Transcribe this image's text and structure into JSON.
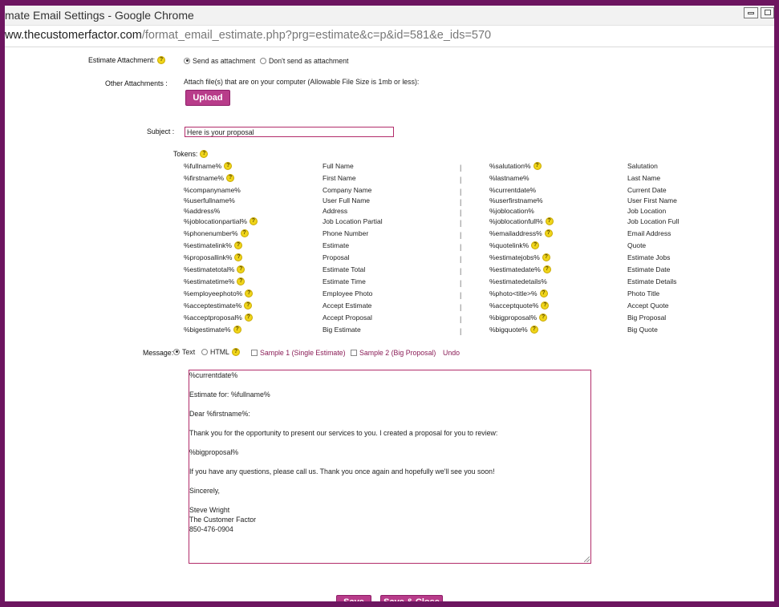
{
  "window": {
    "title": "mate Email Settings - Google Chrome",
    "url_host": "ww.thecustomerfactor.com",
    "url_path": "/format_email_estimate.php?prg=estimate&c=p&id=581&e_ids=570"
  },
  "attachment": {
    "label": "Estimate Attachment:",
    "option_send": "Send as attachment",
    "option_dont": "Don't send as attachment"
  },
  "other_attachments": {
    "label": "Other Attachments :",
    "note": "Attach file(s) that are on your computer (Allowable File Size is 1mb or less):",
    "upload_label": "Upload"
  },
  "subject": {
    "label": "Subject :",
    "value": "Here is your proposal"
  },
  "tokens": {
    "label": "Tokens:",
    "rows": [
      {
        "t1": "%fullname%",
        "h1": true,
        "d1": "Full Name",
        "t2": "%salutation%",
        "h2": true,
        "d2": "Salutation"
      },
      {
        "t1": "%firstname%",
        "h1": true,
        "d1": "First Name",
        "t2": "%lastname%",
        "h2": false,
        "d2": "Last Name"
      },
      {
        "t1": "%companyname%",
        "h1": false,
        "d1": "Company Name",
        "t2": "%currentdate%",
        "h2": false,
        "d2": "Current Date"
      },
      {
        "t1": "%userfullname%",
        "h1": false,
        "d1": "User Full Name",
        "t2": "%userfirstname%",
        "h2": false,
        "d2": "User First Name"
      },
      {
        "t1": "%address%",
        "h1": false,
        "d1": "Address",
        "t2": "%joblocation%",
        "h2": false,
        "d2": "Job Location"
      },
      {
        "t1": "%joblocationpartial%",
        "h1": true,
        "d1": "Job Location Partial",
        "t2": "%joblocationfull%",
        "h2": true,
        "d2": "Job Location Full"
      },
      {
        "t1": "%phonenumber%",
        "h1": true,
        "d1": "Phone Number",
        "t2": "%emailaddress%",
        "h2": true,
        "d2": "Email Address"
      },
      {
        "t1": "%estimatelink%",
        "h1": true,
        "d1": "Estimate",
        "t2": "%quotelink%",
        "h2": true,
        "d2": "Quote"
      },
      {
        "t1": "%proposallink%",
        "h1": true,
        "d1": "Proposal",
        "t2": "%estimatejobs%",
        "h2": true,
        "d2": "Estimate Jobs"
      },
      {
        "t1": "%estimatetotal%",
        "h1": true,
        "d1": "Estimate Total",
        "t2": "%estimatedate%",
        "h2": true,
        "d2": "Estimate Date"
      },
      {
        "t1": "%estimatetime%",
        "h1": true,
        "d1": "Estimate Time",
        "t2": "%estimatedetails%",
        "h2": false,
        "d2": "Estimate Details"
      },
      {
        "t1": "%employeephoto%",
        "h1": true,
        "d1": "Employee Photo",
        "t2": "%photo<title>%",
        "h2": true,
        "d2": "Photo Title"
      },
      {
        "t1": "%acceptestimate%",
        "h1": true,
        "d1": "Accept Estimate",
        "t2": "%acceptquote%",
        "h2": true,
        "d2": "Accept Quote"
      },
      {
        "t1": "%acceptproposal%",
        "h1": true,
        "d1": "Accept Proposal",
        "t2": "%bigproposal%",
        "h2": true,
        "d2": "Big Proposal"
      },
      {
        "t1": "%bigestimate%",
        "h1": true,
        "d1": "Big Estimate",
        "t2": "%bigquote%",
        "h2": true,
        "d2": "Big Quote"
      }
    ],
    "separator": "|",
    "help_glyph": "?"
  },
  "message": {
    "label": "Message:",
    "format_text": "Text",
    "format_html": "HTML",
    "sample1": "Sample 1 (Single Estimate)",
    "sample2": "Sample 2 (Big Proposal)",
    "undo": "Undo",
    "lines": [
      "%currentdate%",
      "",
      "Estimate for: %fullname%",
      "",
      "Dear %firstname%:",
      "",
      "Thank you for the opportunity to present our services to you. I created a proposal for you to review:",
      "",
      "%bigproposal%",
      "",
      "If you have any questions, please call us. Thank you once again and hopefully we'll see you soon!",
      "",
      "Sincerely,",
      "",
      "Steve Wright",
      "The Customer Factor",
      "850-476-0904"
    ]
  },
  "footer": {
    "save_label": "Save",
    "save_close_label": "Save & Close"
  },
  "colors": {
    "frame": "#6d1560",
    "accent": "#b83c8a",
    "link": "#8a1c56",
    "help_icon": "#f0d51a"
  }
}
